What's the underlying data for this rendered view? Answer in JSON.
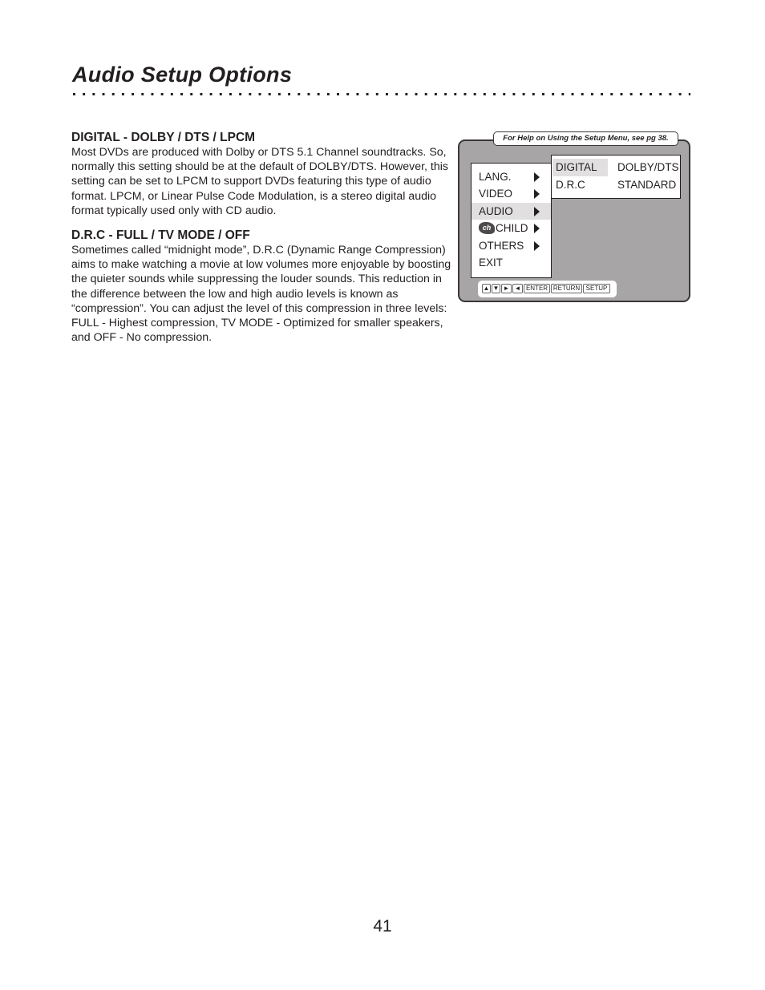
{
  "page": {
    "title": "Audio Setup Options",
    "number": "41"
  },
  "sections": [
    {
      "heading": "DIGITAL - DOLBY / DTS / LPCM",
      "body": "Most DVDs are produced with Dolby or DTS 5.1 Channel soundtracks. So, normally this setting should be at the default of DOLBY/DTS. However, this setting can be set to LPCM to support DVDs featuring this type of audio format. LPCM, or Linear Pulse Code Modulation, is a stereo digital audio format typically used only with CD audio."
    },
    {
      "heading": "D.R.C - FULL / TV MODE / OFF",
      "body": "Sometimes called “midnight mode”, D.R.C (Dynamic Range Compression) aims to make watching a movie at low volumes more enjoyable by boosting the quieter sounds while suppressing the louder sounds. This reduction in the difference between the low and high audio levels is known as “compression”. You can adjust the level of this compression in three levels: FULL - Highest compression, TV MODE - Optimized for smaller speakers, and OFF - No compression."
    }
  ],
  "osd": {
    "help_note": "For Help on Using the Setup Menu, see pg 38.",
    "main_menu": [
      {
        "label": "LANG.",
        "has_submenu": true,
        "selected": false
      },
      {
        "label": "VIDEO",
        "has_submenu": true,
        "selected": false
      },
      {
        "label": "AUDIO",
        "has_submenu": true,
        "selected": true
      },
      {
        "label": "CHILD",
        "has_submenu": true,
        "selected": false,
        "icon": "child-lock-icon"
      },
      {
        "label": "OTHERS",
        "has_submenu": true,
        "selected": false
      },
      {
        "label": "EXIT",
        "has_submenu": false,
        "selected": false
      }
    ],
    "sub_menu": [
      {
        "option": "DIGITAL",
        "value": "DOLBY/DTS",
        "selected": true
      },
      {
        "option": "D.R.C",
        "value": "STANDARD",
        "selected": false
      }
    ],
    "keys": [
      {
        "label": "▲",
        "name": "up"
      },
      {
        "label": "▼",
        "name": "down"
      },
      {
        "label": "►",
        "name": "right"
      },
      {
        "label": "◄",
        "name": "left"
      },
      {
        "label": "ENTER",
        "name": "enter"
      },
      {
        "label": "RETURN",
        "name": "return"
      },
      {
        "label": "SETUP",
        "name": "setup"
      }
    ],
    "colors": {
      "panel_bg": "#a7a5a6",
      "highlight": "#e1dfe0"
    }
  }
}
